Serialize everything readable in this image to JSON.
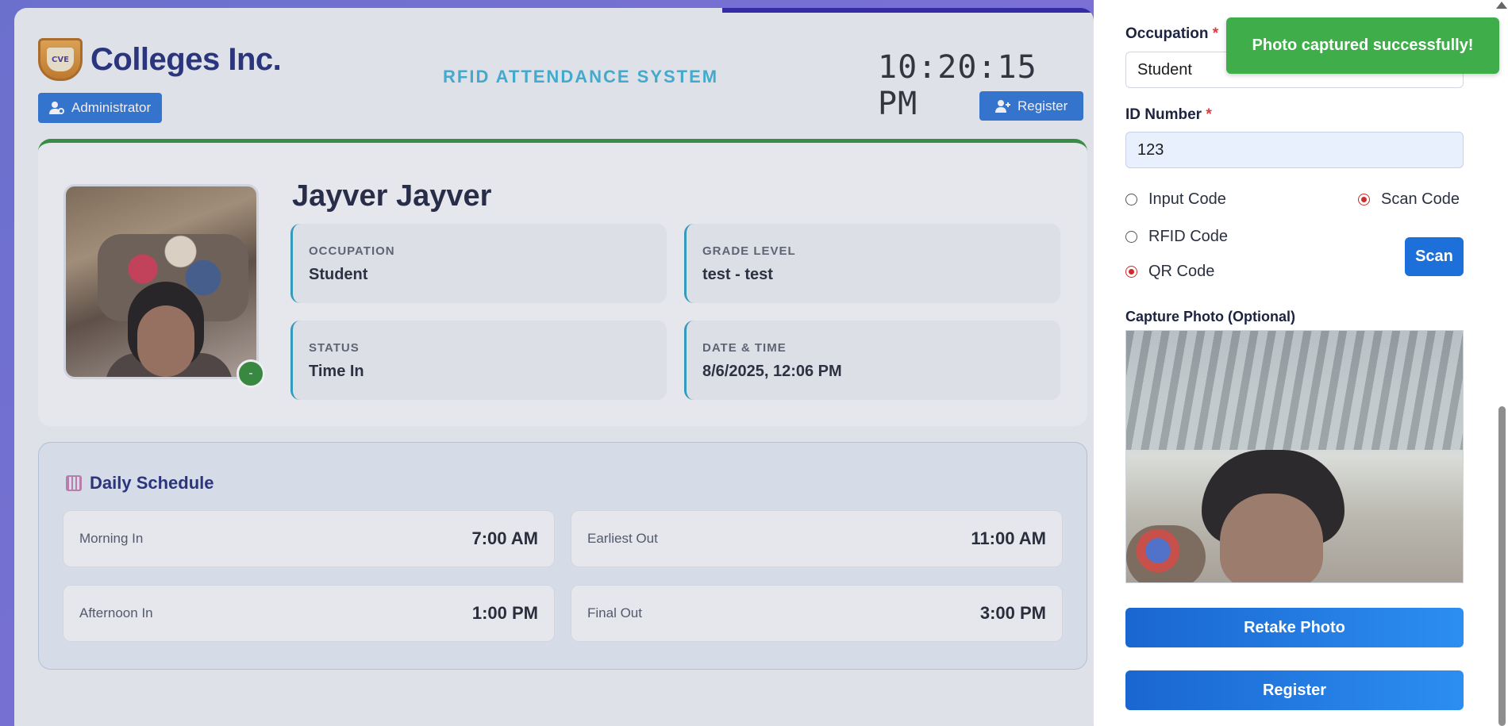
{
  "header": {
    "brand": "Colleges Inc.",
    "logo_text": "CVE",
    "system_title": "RFID ATTENDANCE SYSTEM",
    "clock": "10:20:15 PM",
    "admin_button": "Administrator",
    "register_button": "Register"
  },
  "profile": {
    "name": "Jayver Jayver",
    "status_dot": "-",
    "fields": [
      {
        "label": "OCCUPATION",
        "value": "Student"
      },
      {
        "label": "GRADE LEVEL",
        "value": "test - test"
      },
      {
        "label": "STATUS",
        "value": "Time In"
      },
      {
        "label": "DATE & TIME",
        "value": "8/6/2025, 12:06 PM"
      }
    ]
  },
  "schedule": {
    "title": "Daily Schedule",
    "items": [
      {
        "label": "Morning In",
        "value": "7:00 AM"
      },
      {
        "label": "Earliest Out",
        "value": "11:00 AM"
      },
      {
        "label": "Afternoon In",
        "value": "1:00 PM"
      },
      {
        "label": "Final Out",
        "value": "3:00 PM"
      }
    ]
  },
  "form": {
    "occupation_label": "Occupation",
    "occupation_value": "Student",
    "id_label": "ID Number",
    "id_value": "123",
    "required_mark": "*",
    "radios": {
      "input_code": "Input Code",
      "scan_code": "Scan Code",
      "rfid_code": "RFID Code",
      "qr_code": "QR Code"
    },
    "scan_button": "Scan",
    "capture_label": "Capture Photo (Optional)",
    "retake_button": "Retake Photo",
    "register_button": "Register"
  },
  "toast": {
    "message": "Photo captured successfully!"
  },
  "colors": {
    "accent_blue": "#2b73d6",
    "success_green": "#3fae4a",
    "brand_navy": "#1e2b7a",
    "radio_selected": "#d12a2a"
  }
}
